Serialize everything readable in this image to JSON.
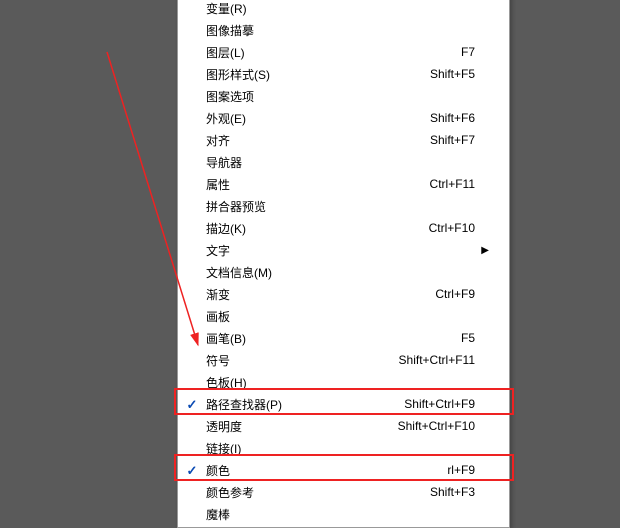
{
  "menu": {
    "items": [
      {
        "label": "变量(R)",
        "shortcut": "",
        "checked": false,
        "hasSubmenu": false
      },
      {
        "label": "图像描摹",
        "shortcut": "",
        "checked": false,
        "hasSubmenu": false
      },
      {
        "label": "图层(L)",
        "shortcut": "F7",
        "checked": false,
        "hasSubmenu": false
      },
      {
        "label": "图形样式(S)",
        "shortcut": "Shift+F5",
        "checked": false,
        "hasSubmenu": false
      },
      {
        "label": "图案选项",
        "shortcut": "",
        "checked": false,
        "hasSubmenu": false
      },
      {
        "label": "外观(E)",
        "shortcut": "Shift+F6",
        "checked": false,
        "hasSubmenu": false
      },
      {
        "label": "对齐",
        "shortcut": "Shift+F7",
        "checked": false,
        "hasSubmenu": false
      },
      {
        "label": "导航器",
        "shortcut": "",
        "checked": false,
        "hasSubmenu": false
      },
      {
        "label": "属性",
        "shortcut": "Ctrl+F11",
        "checked": false,
        "hasSubmenu": false
      },
      {
        "label": "拼合器预览",
        "shortcut": "",
        "checked": false,
        "hasSubmenu": false
      },
      {
        "label": "描边(K)",
        "shortcut": "Ctrl+F10",
        "checked": false,
        "hasSubmenu": false
      },
      {
        "label": "文字",
        "shortcut": "",
        "checked": false,
        "hasSubmenu": true
      },
      {
        "label": "文档信息(M)",
        "shortcut": "",
        "checked": false,
        "hasSubmenu": false
      },
      {
        "label": "渐变",
        "shortcut": "Ctrl+F9",
        "checked": false,
        "hasSubmenu": false
      },
      {
        "label": "画板",
        "shortcut": "",
        "checked": false,
        "hasSubmenu": false
      },
      {
        "label": "画笔(B)",
        "shortcut": "F5",
        "checked": false,
        "hasSubmenu": false
      },
      {
        "label": "符号",
        "shortcut": "Shift+Ctrl+F11",
        "checked": false,
        "hasSubmenu": false
      },
      {
        "label": "色板(H)",
        "shortcut": "",
        "checked": false,
        "hasSubmenu": false
      },
      {
        "label": "路径查找器(P)",
        "shortcut": "Shift+Ctrl+F9",
        "checked": true,
        "hasSubmenu": false
      },
      {
        "label": "透明度",
        "shortcut": "Shift+Ctrl+F10",
        "checked": false,
        "hasSubmenu": false
      },
      {
        "label": "链接(I)",
        "shortcut": "",
        "checked": false,
        "hasSubmenu": false
      },
      {
        "label": "颜色",
        "shortcut": "rl+F9",
        "checked": true,
        "hasSubmenu": false
      },
      {
        "label": "颜色参考",
        "shortcut": "Shift+F3",
        "checked": false,
        "hasSubmenu": false
      },
      {
        "label": "魔棒",
        "shortcut": "",
        "checked": false,
        "hasSubmenu": false
      }
    ]
  },
  "submenuArrow": "▶"
}
